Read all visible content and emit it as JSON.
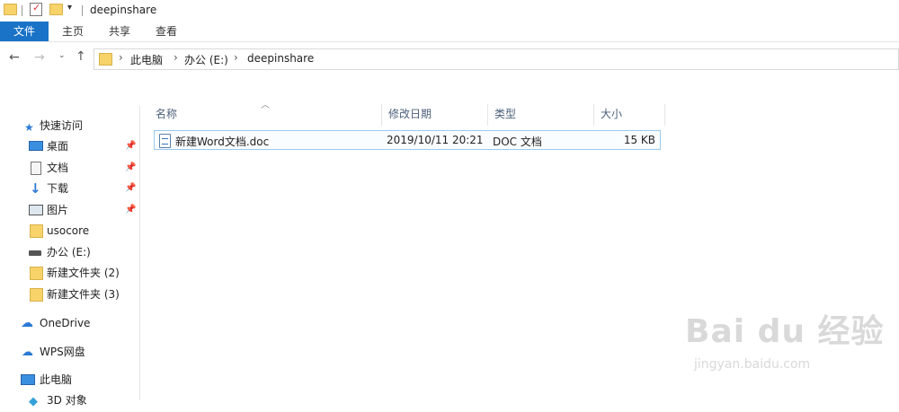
{
  "window": {
    "title": "deepinshare"
  },
  "ribbon": {
    "tabs": [
      "文件",
      "主页",
      "共享",
      "查看"
    ]
  },
  "address": {
    "crumbs": [
      "此电脑",
      "办公 (E:)",
      "deepinshare"
    ]
  },
  "nav": {
    "quick_access": "快速访问",
    "pinned": [
      {
        "label": "桌面",
        "icon": "desktop-icon",
        "pinned": true
      },
      {
        "label": "文档",
        "icon": "document-icon",
        "pinned": true
      },
      {
        "label": "下载",
        "icon": "download-icon",
        "pinned": true
      },
      {
        "label": "图片",
        "icon": "pictures-icon",
        "pinned": true
      },
      {
        "label": "usocore",
        "icon": "folder-icon",
        "pinned": false
      },
      {
        "label": "办公 (E:)",
        "icon": "drive-icon",
        "pinned": false
      },
      {
        "label": "新建文件夹 (2)",
        "icon": "folder-icon",
        "pinned": false
      },
      {
        "label": "新建文件夹 (3)",
        "icon": "folder-icon",
        "pinned": false
      }
    ],
    "onedrive": "OneDrive",
    "wps": "WPS网盘",
    "this_pc": "此电脑",
    "objects3d": "3D 对象"
  },
  "columns": {
    "name": "名称",
    "modified": "修改日期",
    "type": "类型",
    "size": "大小"
  },
  "files": [
    {
      "name": "新建Word文档.doc",
      "modified": "2019/10/11 20:21",
      "type": "DOC 文档",
      "size": "15 KB"
    }
  ],
  "watermark": {
    "main": "Bai du 经验",
    "sub": "jingyan.baidu.com"
  },
  "colors": {
    "accent": "#1a73c7",
    "selection_border": "#99c9ef"
  }
}
